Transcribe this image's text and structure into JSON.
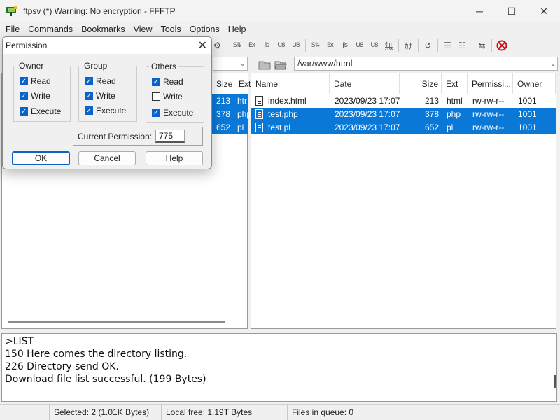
{
  "window": {
    "title": "ftpsv (*) Warning: No encryption - FFFTP",
    "minimize": "─",
    "maximize": "☐",
    "close": "✕"
  },
  "menu": [
    "File",
    "Commands",
    "Bookmarks",
    "View",
    "Tools",
    "Options",
    "Help"
  ],
  "toolbar": {
    "glyphs": [
      "S⇅",
      "Ex",
      "Jis",
      "U8",
      "U8",
      "S⇅",
      "Ex",
      "Jis",
      "U8",
      "U8",
      "無",
      "ｶﾅ",
      "↺",
      "☰",
      "☷",
      "⇆"
    ]
  },
  "local": {
    "columns": {
      "size": "Size",
      "ext": "Ext"
    },
    "rows": [
      {
        "size": "213",
        "ext": "htr",
        "selected": true
      },
      {
        "size": "378",
        "ext": "php",
        "selected": true
      },
      {
        "size": "652",
        "ext": "pl",
        "selected": true
      }
    ]
  },
  "remote": {
    "path": "/var/www/html",
    "columns": {
      "name": "Name",
      "date": "Date",
      "size": "Size",
      "ext": "Ext",
      "permission": "Permissi...",
      "owner": "Owner"
    },
    "rows": [
      {
        "name": "index.html",
        "date": "2023/09/23 17:07",
        "size": "213",
        "ext": "html",
        "permission": "rw-rw-r--",
        "owner": "1001",
        "selected": false
      },
      {
        "name": "test.php",
        "date": "2023/09/23 17:07",
        "size": "378",
        "ext": "php",
        "permission": "rw-rw-r--",
        "owner": "1001",
        "selected": true
      },
      {
        "name": "test.pl",
        "date": "2023/09/23 17:07",
        "size": "652",
        "ext": "pl",
        "permission": "rw-rw-r--",
        "owner": "1001",
        "selected": true
      }
    ]
  },
  "log": [
    ">LIST",
    "150 Here comes the directory listing.",
    "226 Directory send OK.",
    "Download file list successful. (199 Bytes)"
  ],
  "status": {
    "selected": "Selected: 2 (1.01K Bytes)",
    "local_free": "Local free: 1.19T Bytes",
    "queue": "Files in queue: 0"
  },
  "dialog": {
    "title": "Permission",
    "close": "✕",
    "owner": {
      "title": "Owner",
      "read": "Read",
      "write": "Write",
      "execute": "Execute",
      "read_on": true,
      "write_on": true,
      "execute_on": true
    },
    "group": {
      "title": "Group",
      "read": "Read",
      "write": "Write",
      "execute": "Execute",
      "read_on": true,
      "write_on": true,
      "execute_on": true
    },
    "others": {
      "title": "Others",
      "read": "Read",
      "write": "Write",
      "execute": "Execute",
      "read_on": true,
      "write_on": false,
      "execute_on": true
    },
    "current_label": "Current Permission:",
    "current_value": "775",
    "ok": "OK",
    "cancel": "Cancel",
    "help": "Help"
  },
  "colors": {
    "selection": "#0a78d7",
    "checkbox": "#0a64c8"
  }
}
